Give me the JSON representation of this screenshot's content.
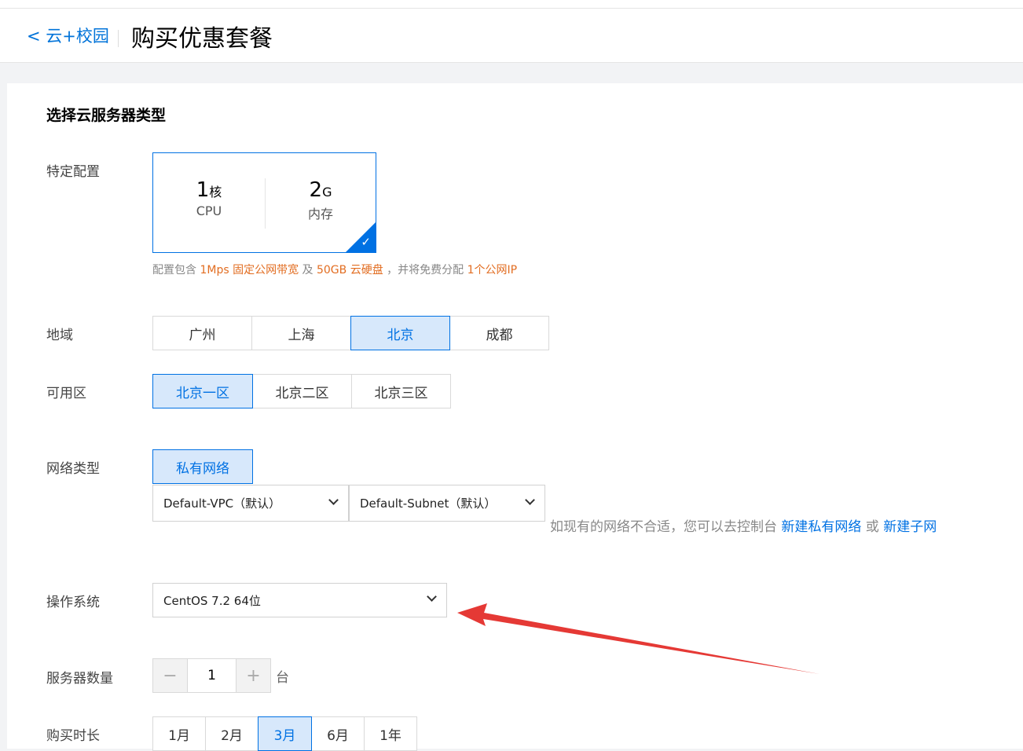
{
  "header": {
    "back_label": "< 云+校园",
    "page_title": "购买优惠套餐"
  },
  "main": {
    "section_title": "选择云服务器类型",
    "spec": {
      "label": "特定配置",
      "cpu_value": "1",
      "cpu_unit": "核",
      "cpu_caption": "CPU",
      "mem_value": "2",
      "mem_unit": "G",
      "mem_caption": "内存",
      "note": {
        "t1": "配置包含 ",
        "h1": "1Mps 固定公网带宽",
        "t2": " 及 ",
        "h2": "50GB 云硬盘",
        "t3": " ，并将免费分配 ",
        "h3": "1个公网IP"
      }
    },
    "region": {
      "label": "地域",
      "options": [
        "广州",
        "上海",
        "北京",
        "成都"
      ],
      "selected": "北京"
    },
    "zone": {
      "label": "可用区",
      "options": [
        "北京一区",
        "北京二区",
        "北京三区"
      ],
      "selected": "北京一区"
    },
    "network": {
      "label": "网络类型",
      "type_button": "私有网络",
      "vpc_value": "Default-VPC（默认）",
      "subnet_value": "Default-Subnet（默认）",
      "hint_text": "如现有的网络不合适，您可以去控制台 ",
      "link_new_vpc": "新建私有网络",
      "or_text": " 或 ",
      "link_new_subnet": "新建子网"
    },
    "os": {
      "label": "操作系统",
      "value": "CentOS 7.2 64位"
    },
    "quantity": {
      "label": "服务器数量",
      "value": "1",
      "minus": "−",
      "plus": "+",
      "unit": "台"
    },
    "duration": {
      "label": "购买时长",
      "options": [
        "1月",
        "2月",
        "3月",
        "6月",
        "1年"
      ],
      "selected": "3月"
    },
    "colors": {
      "accent": "#0071e3",
      "selected_bg": "#d7e8fb",
      "highlight": "#e26d21",
      "annotation_arrow": "#e53935"
    }
  }
}
